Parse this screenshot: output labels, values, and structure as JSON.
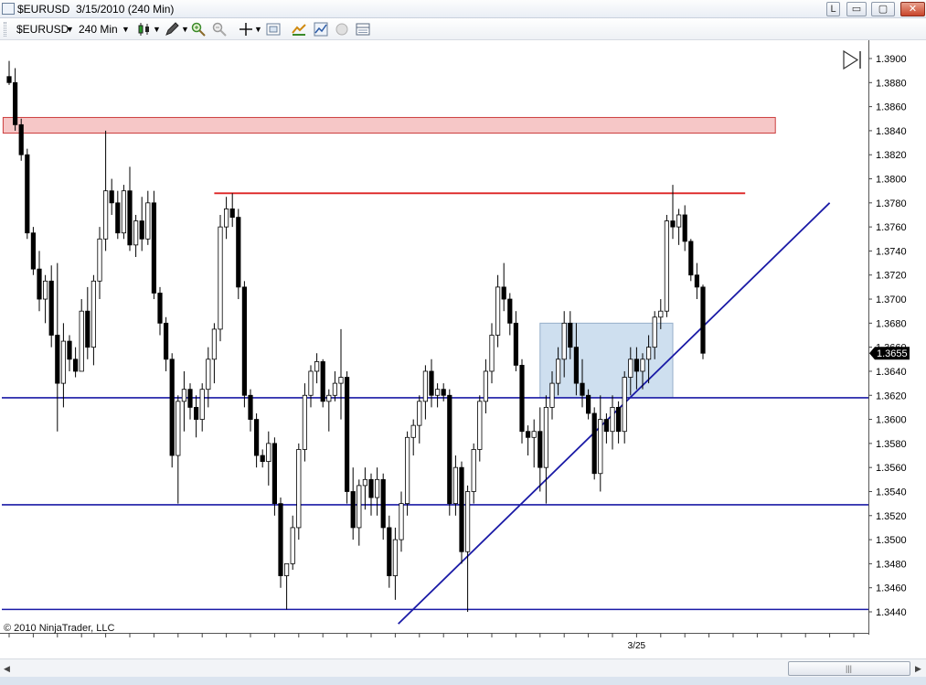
{
  "window": {
    "title": "$EURUSD  3/15/2010 (240 Min)",
    "buttons": {
      "l": "L",
      "minimize": "▭",
      "maximize": "▢",
      "close": "✕"
    }
  },
  "toolbar": {
    "instrument": "$EURUSD",
    "interval": "240 Min",
    "icons": [
      "candlestick-icon",
      "pencil-icon",
      "zoom-in-icon",
      "zoom-out-icon",
      "crosshair-icon",
      "properties-icon",
      "strategy-icon",
      "indicator-icon",
      "circle-icon",
      "data-box-icon"
    ]
  },
  "scrollbar": {
    "left": "◀",
    "right": "▶",
    "grip": "|||"
  },
  "chart_data": {
    "type": "candlestick",
    "instrument": "$EURUSD",
    "interval": "240 Min",
    "ylim": [
      1.3432,
      1.3912
    ],
    "y_ticks": [
      "1.3900",
      "1.3880",
      "1.3860",
      "1.3840",
      "1.3820",
      "1.3800",
      "1.3780",
      "1.3760",
      "1.3740",
      "1.3720",
      "1.3700",
      "1.3680",
      "1.3660",
      "1.3640",
      "1.3620",
      "1.3600",
      "1.3580",
      "1.3560",
      "1.3540",
      "1.3520",
      "1.3500",
      "1.3480",
      "1.3460",
      "1.3440"
    ],
    "x_labels": [
      {
        "label": "3/25",
        "bar": 104
      }
    ],
    "last_price": "1.3655",
    "copyright": "© 2010 NinjaTrader, LLC",
    "colors": {
      "bull": "#ffffff",
      "bear": "#000000",
      "hline": "#1a1aa6",
      "resistance": "#dd2222",
      "zone_red": "#f6c2c2",
      "zone_blue": "#c9dcee"
    },
    "candles": [
      [
        1.3885,
        1.3898,
        1.3878,
        1.388
      ],
      [
        1.388,
        1.3892,
        1.384,
        1.3845
      ],
      [
        1.3845,
        1.385,
        1.3815,
        1.382
      ],
      [
        1.382,
        1.3825,
        1.375,
        1.3755
      ],
      [
        1.3755,
        1.376,
        1.372,
        1.3725
      ],
      [
        1.3725,
        1.374,
        1.369,
        1.37
      ],
      [
        1.37,
        1.372,
        1.368,
        1.3715
      ],
      [
        1.3715,
        1.3728,
        1.366,
        1.367
      ],
      [
        1.367,
        1.373,
        1.359,
        1.363
      ],
      [
        1.363,
        1.368,
        1.361,
        1.3665
      ],
      [
        1.3665,
        1.367,
        1.364,
        1.365
      ],
      [
        1.365,
        1.366,
        1.3635,
        1.364
      ],
      [
        1.364,
        1.37,
        1.364,
        1.369
      ],
      [
        1.369,
        1.371,
        1.365,
        1.366
      ],
      [
        1.366,
        1.372,
        1.3645,
        1.3715
      ],
      [
        1.3715,
        1.376,
        1.37,
        1.375
      ],
      [
        1.375,
        1.384,
        1.374,
        1.379
      ],
      [
        1.379,
        1.38,
        1.377,
        1.378
      ],
      [
        1.378,
        1.379,
        1.375,
        1.3755
      ],
      [
        1.3755,
        1.3795,
        1.375,
        1.379
      ],
      [
        1.379,
        1.381,
        1.374,
        1.3745
      ],
      [
        1.3745,
        1.377,
        1.3735,
        1.3765
      ],
      [
        1.3765,
        1.3785,
        1.374,
        1.375
      ],
      [
        1.375,
        1.379,
        1.3745,
        1.378
      ],
      [
        1.378,
        1.379,
        1.37,
        1.3705
      ],
      [
        1.3705,
        1.371,
        1.367,
        1.368
      ],
      [
        1.368,
        1.3685,
        1.364,
        1.365
      ],
      [
        1.365,
        1.3655,
        1.356,
        1.357
      ],
      [
        1.357,
        1.362,
        1.353,
        1.3615
      ],
      [
        1.3615,
        1.364,
        1.359,
        1.3625
      ],
      [
        1.3625,
        1.363,
        1.36,
        1.361
      ],
      [
        1.361,
        1.362,
        1.3585,
        1.36
      ],
      [
        1.36,
        1.363,
        1.359,
        1.3625
      ],
      [
        1.3625,
        1.366,
        1.361,
        1.365
      ],
      [
        1.365,
        1.368,
        1.363,
        1.3675
      ],
      [
        1.3675,
        1.377,
        1.3665,
        1.376
      ],
      [
        1.376,
        1.3785,
        1.375,
        1.3775
      ],
      [
        1.3775,
        1.3788,
        1.376,
        1.3768
      ],
      [
        1.3768,
        1.3775,
        1.37,
        1.371
      ],
      [
        1.371,
        1.3715,
        1.361,
        1.362
      ],
      [
        1.362,
        1.3625,
        1.359,
        1.36
      ],
      [
        1.36,
        1.3605,
        1.356,
        1.357
      ],
      [
        1.357,
        1.3575,
        1.356,
        1.3565
      ],
      [
        1.3565,
        1.359,
        1.3545,
        1.358
      ],
      [
        1.358,
        1.3585,
        1.352,
        1.353
      ],
      [
        1.353,
        1.3535,
        1.346,
        1.347
      ],
      [
        1.347,
        1.348,
        1.3442,
        1.348
      ],
      [
        1.348,
        1.352,
        1.3475,
        1.351
      ],
      [
        1.351,
        1.358,
        1.35,
        1.3575
      ],
      [
        1.3575,
        1.363,
        1.3565,
        1.362
      ],
      [
        1.362,
        1.3645,
        1.361,
        1.364
      ],
      [
        1.364,
        1.3655,
        1.363,
        1.3648
      ],
      [
        1.3648,
        1.365,
        1.361,
        1.3615
      ],
      [
        1.3615,
        1.3625,
        1.359,
        1.362
      ],
      [
        1.362,
        1.364,
        1.3615,
        1.363
      ],
      [
        1.363,
        1.3675,
        1.36,
        1.3635
      ],
      [
        1.3635,
        1.364,
        1.353,
        1.354
      ],
      [
        1.354,
        1.356,
        1.35,
        1.351
      ],
      [
        1.351,
        1.355,
        1.3495,
        1.3545
      ],
      [
        1.3545,
        1.356,
        1.3525,
        1.355
      ],
      [
        1.355,
        1.3555,
        1.352,
        1.3535
      ],
      [
        1.3535,
        1.356,
        1.352,
        1.355
      ],
      [
        1.355,
        1.3555,
        1.35,
        1.351
      ],
      [
        1.351,
        1.352,
        1.346,
        1.347
      ],
      [
        1.347,
        1.351,
        1.345,
        1.35
      ],
      [
        1.35,
        1.354,
        1.349,
        1.353
      ],
      [
        1.353,
        1.359,
        1.352,
        1.3585
      ],
      [
        1.3585,
        1.36,
        1.357,
        1.3595
      ],
      [
        1.3595,
        1.362,
        1.358,
        1.3615
      ],
      [
        1.3615,
        1.3645,
        1.36,
        1.364
      ],
      [
        1.364,
        1.365,
        1.361,
        1.362
      ],
      [
        1.362,
        1.363,
        1.361,
        1.3625
      ],
      [
        1.3625,
        1.363,
        1.3615,
        1.362
      ],
      [
        1.362,
        1.3625,
        1.352,
        1.353
      ],
      [
        1.353,
        1.357,
        1.352,
        1.356
      ],
      [
        1.356,
        1.3565,
        1.348,
        1.349
      ],
      [
        1.349,
        1.3545,
        1.344,
        1.354
      ],
      [
        1.354,
        1.358,
        1.353,
        1.3575
      ],
      [
        1.3575,
        1.362,
        1.3565,
        1.3615
      ],
      [
        1.3615,
        1.365,
        1.3605,
        1.364
      ],
      [
        1.364,
        1.368,
        1.363,
        1.367
      ],
      [
        1.367,
        1.372,
        1.366,
        1.371
      ],
      [
        1.371,
        1.373,
        1.369,
        1.37
      ],
      [
        1.37,
        1.3705,
        1.367,
        1.368
      ],
      [
        1.368,
        1.369,
        1.364,
        1.3645
      ],
      [
        1.3645,
        1.365,
        1.358,
        1.359
      ],
      [
        1.359,
        1.3595,
        1.357,
        1.3585
      ],
      [
        1.3585,
        1.36,
        1.356,
        1.359
      ],
      [
        1.359,
        1.361,
        1.354,
        1.356
      ],
      [
        1.356,
        1.362,
        1.353,
        1.361
      ],
      [
        1.361,
        1.364,
        1.36,
        1.363
      ],
      [
        1.363,
        1.366,
        1.362,
        1.365
      ],
      [
        1.365,
        1.369,
        1.3635,
        1.368
      ],
      [
        1.368,
        1.369,
        1.365,
        1.366
      ],
      [
        1.366,
        1.368,
        1.362,
        1.363
      ],
      [
        1.363,
        1.365,
        1.361,
        1.362
      ],
      [
        1.362,
        1.3625,
        1.36,
        1.3605
      ],
      [
        1.3605,
        1.361,
        1.355,
        1.3555
      ],
      [
        1.3555,
        1.362,
        1.354,
        1.36
      ],
      [
        1.36,
        1.3605,
        1.358,
        1.359
      ],
      [
        1.359,
        1.362,
        1.3575,
        1.361
      ],
      [
        1.361,
        1.3615,
        1.358,
        1.359
      ],
      [
        1.359,
        1.364,
        1.358,
        1.3635
      ],
      [
        1.3635,
        1.366,
        1.362,
        1.365
      ],
      [
        1.365,
        1.366,
        1.3625,
        1.364
      ],
      [
        1.364,
        1.3655,
        1.3625,
        1.365
      ],
      [
        1.365,
        1.367,
        1.363,
        1.366
      ],
      [
        1.366,
        1.369,
        1.365,
        1.3685
      ],
      [
        1.3685,
        1.37,
        1.3675,
        1.369
      ],
      [
        1.369,
        1.377,
        1.3685,
        1.3765
      ],
      [
        1.3765,
        1.3795,
        1.375,
        1.376
      ],
      [
        1.376,
        1.3775,
        1.3745,
        1.377
      ],
      [
        1.377,
        1.3778,
        1.374,
        1.3748
      ],
      [
        1.3748,
        1.375,
        1.3715,
        1.372
      ],
      [
        1.372,
        1.373,
        1.37,
        1.371
      ],
      [
        1.371,
        1.3712,
        1.365,
        1.3655
      ]
    ],
    "horizontal_lines": [
      1.3618,
      1.3529,
      1.3442
    ],
    "resistance_line": {
      "from_bar": 34,
      "to_bar": 122,
      "price": 1.3788
    },
    "zones": [
      {
        "color": "red",
        "from_bar": -1,
        "to_bar": 127,
        "high": 1.3851,
        "low": 1.3838
      },
      {
        "color": "blue",
        "from_bar": 88,
        "to_bar": 110,
        "high": 1.368,
        "low": 1.3618
      }
    ],
    "trendline": {
      "from": [
        64.5,
        1.343
      ],
      "to": [
        136,
        1.378
      ]
    }
  }
}
